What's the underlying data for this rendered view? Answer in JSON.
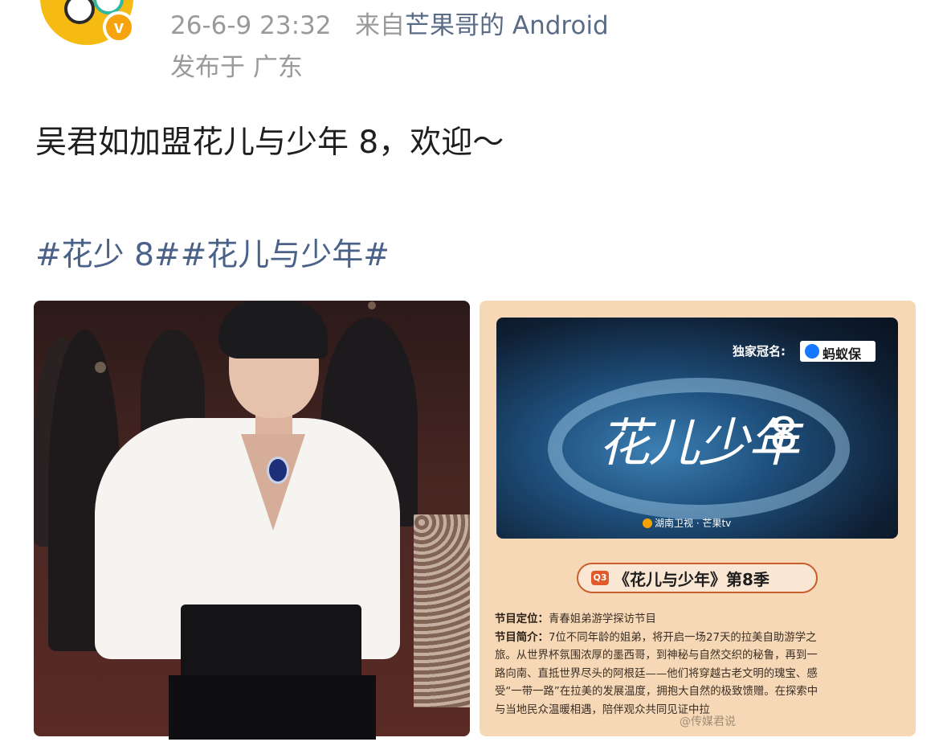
{
  "post": {
    "timestamp": "26-6-9 23:32",
    "source_prefix": "来自",
    "source": "芒果哥的 Android",
    "location": "发布于 广东",
    "text": "吴君如加盟花儿与少年 8，欢迎～",
    "hashtags": "#花少 8##花儿与少年#",
    "verified_badge": "v"
  },
  "poster": {
    "sponsor_label": "独家冠名:",
    "sponsor_name": "蚂蚁保",
    "title": "花儿少年",
    "title_number": "8",
    "channel_logos": "湖南卫视 · 芒果tv",
    "quarter_badge": "Q3",
    "season_title": "《花儿与少年》第8季",
    "positioning_label": "节目定位：",
    "positioning": "青春姐弟游学探访节目",
    "intro_label": "节目简介：",
    "intro_lines": [
      "7位不同年龄的姐弟，将开启一场27天的拉美自助游学之",
      "旅。从世界杯氛围浓厚的墨西哥，到神秘与自然交织的秘鲁，再到一",
      "路向南、直抵世界尽头的阿根廷——他们将穿越古老文明的瑰宝、感",
      "受“一带一路”在拉美的发展温度，拥抱大自然的极致馈赠。在探索中",
      "与当地民众温暖相遇，陪伴观众共同见证中拉"
    ],
    "watermark": "@传媒君说"
  },
  "colors": {
    "timestamp": "#9a9a9a",
    "source_link": "#5a6b86",
    "hashtag": "#4a6189",
    "avatar": "#f6bb12",
    "poster_bg": "#f6d8b6",
    "pill_border": "#c95e2b"
  }
}
